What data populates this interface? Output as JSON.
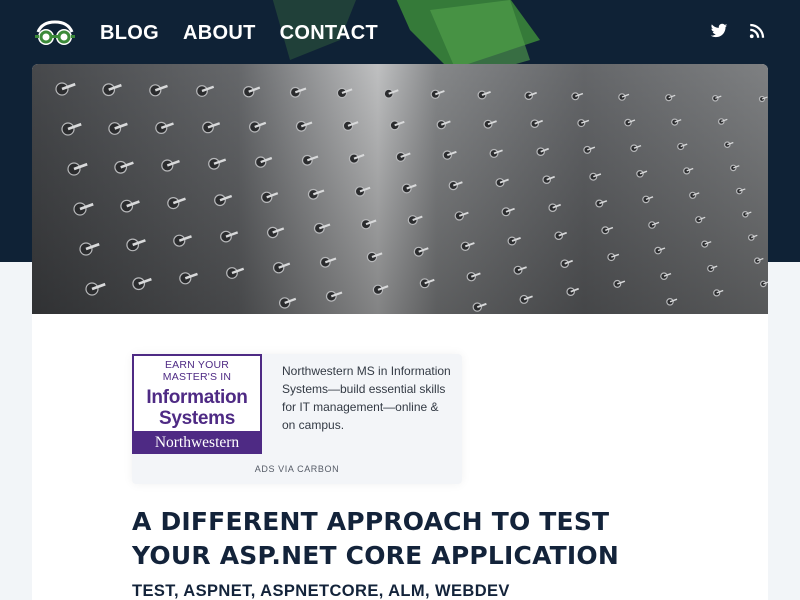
{
  "nav": {
    "links": [
      {
        "label": "BLOG"
      },
      {
        "label": "ABOUT"
      },
      {
        "label": "CONTACT"
      }
    ],
    "icons": [
      "twitter-icon",
      "rss-icon"
    ]
  },
  "ad": {
    "logo_line1": "EARN YOUR",
    "logo_line2": "MASTER'S IN",
    "logo_line3": "Information",
    "logo_line4": "Systems",
    "logo_bar": "Northwestern",
    "text": "Northwestern MS in Information Systems—build essential skills for IT management—online & on campus.",
    "via": "ADS VIA CARBON"
  },
  "post": {
    "title": "A DIFFERENT APPROACH TO TEST YOUR ASP.NET CORE APPLICATION",
    "tags": "TEST, ASPNET, ASPNETCORE, ALM, WEBDEV"
  },
  "colors": {
    "header_bg": "#0f2236",
    "page_bg": "#f2f5f8",
    "brand_purple": "#4e2a84",
    "title_text": "#13233a",
    "accent_green": "#3c8a3a"
  }
}
